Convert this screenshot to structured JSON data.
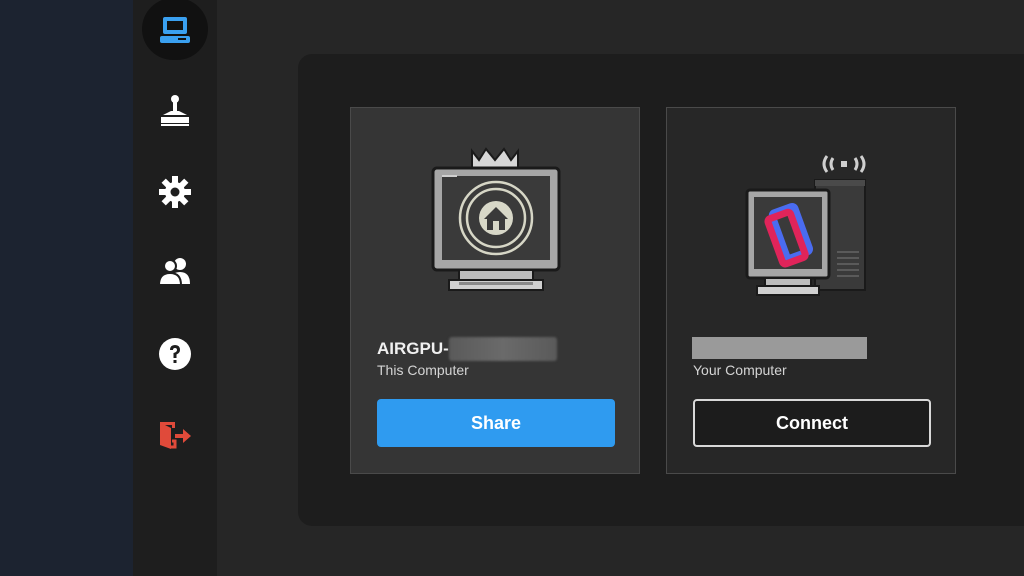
{
  "nav": {
    "items": [
      {
        "name": "computer",
        "active": true
      },
      {
        "name": "controller",
        "active": false
      },
      {
        "name": "settings",
        "active": false
      },
      {
        "name": "friends",
        "active": false
      },
      {
        "name": "help",
        "active": false
      },
      {
        "name": "logout",
        "active": false
      }
    ]
  },
  "cards": {
    "this_computer": {
      "name_prefix": "AIRGPU-",
      "subtitle": "This Computer",
      "button_label": "Share"
    },
    "your_computer": {
      "subtitle": "Your Computer",
      "button_label": "Connect"
    }
  },
  "colors": {
    "accent": "#2f9bf0",
    "logout": "#e04a3a",
    "active_icon": "#3aa0f0"
  }
}
